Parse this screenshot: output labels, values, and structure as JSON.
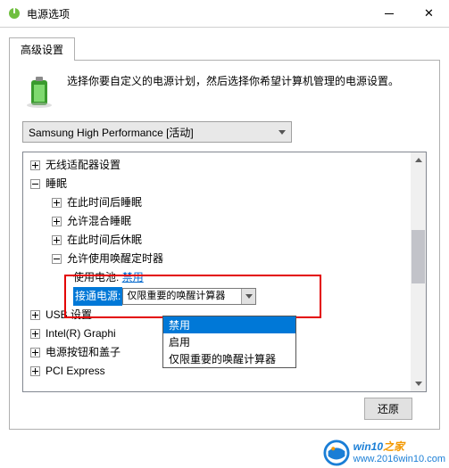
{
  "titlebar": {
    "title": "电源选项"
  },
  "tab": {
    "label": "高级设置"
  },
  "header": {
    "text": "选择你要自定义的电源计划，然后选择你希望计算机管理的电源设置。"
  },
  "plan": {
    "selected": "Samsung High Performance [活动]"
  },
  "tree": {
    "wireless": "无线适配器设置",
    "sleep": "睡眠",
    "sleep_after": "在此时间后睡眠",
    "hybrid": "允许混合睡眠",
    "hibernate_after": "在此时间后休眠",
    "wake_timers": "允许使用唤醒定时器",
    "on_battery_label": "使用电池:",
    "on_battery_value": "禁用",
    "plugged_label": "接通电源:",
    "plugged_value": "仅限重要的唤醒计算器",
    "usb": "USB 设置",
    "intel": "Intel(R) Graphi",
    "buttons_lid": "电源按钮和盖子",
    "pci": "PCI Express"
  },
  "dropdown": {
    "opt1": "禁用",
    "opt2": "启用",
    "opt3": "仅限重要的唤醒计算器"
  },
  "buttons": {
    "restore": "还原"
  },
  "watermark": {
    "brand_a": "win10",
    "brand_b": "之家",
    "url": "www.2016win10.com"
  }
}
